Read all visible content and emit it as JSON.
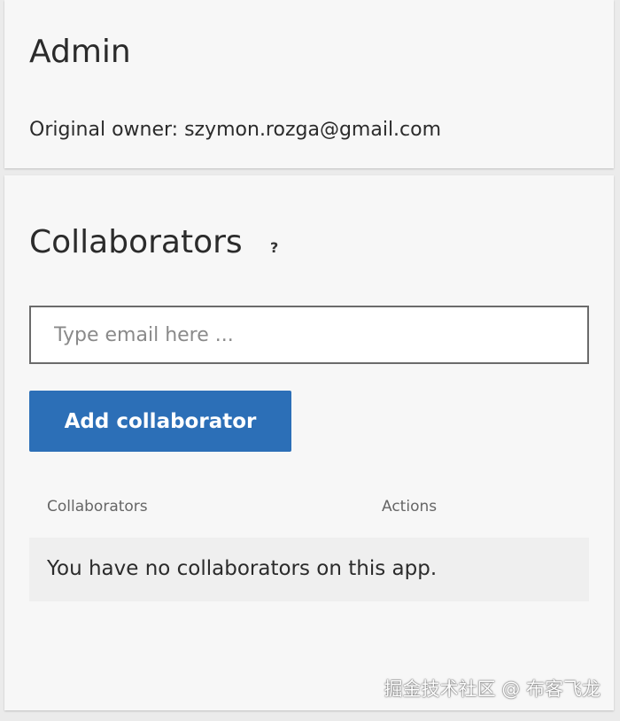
{
  "admin": {
    "title": "Admin",
    "owner_text": "Original owner: szymon.rozga@gmail.com"
  },
  "collaborators": {
    "title": "Collaborators",
    "help_symbol": "?",
    "email_placeholder": "Type email here ...",
    "email_value": "",
    "add_button_label": "Add collaborator",
    "table": {
      "columns": [
        "Collaborators",
        "Actions"
      ],
      "empty_message": "You have no collaborators on this app."
    }
  },
  "watermark": {
    "text": "掘金技术社区 @ 布客飞龙"
  },
  "colors": {
    "primary_button": "#2c6fb7",
    "card_background": "#f7f7f7",
    "page_background": "#ebebeb"
  }
}
